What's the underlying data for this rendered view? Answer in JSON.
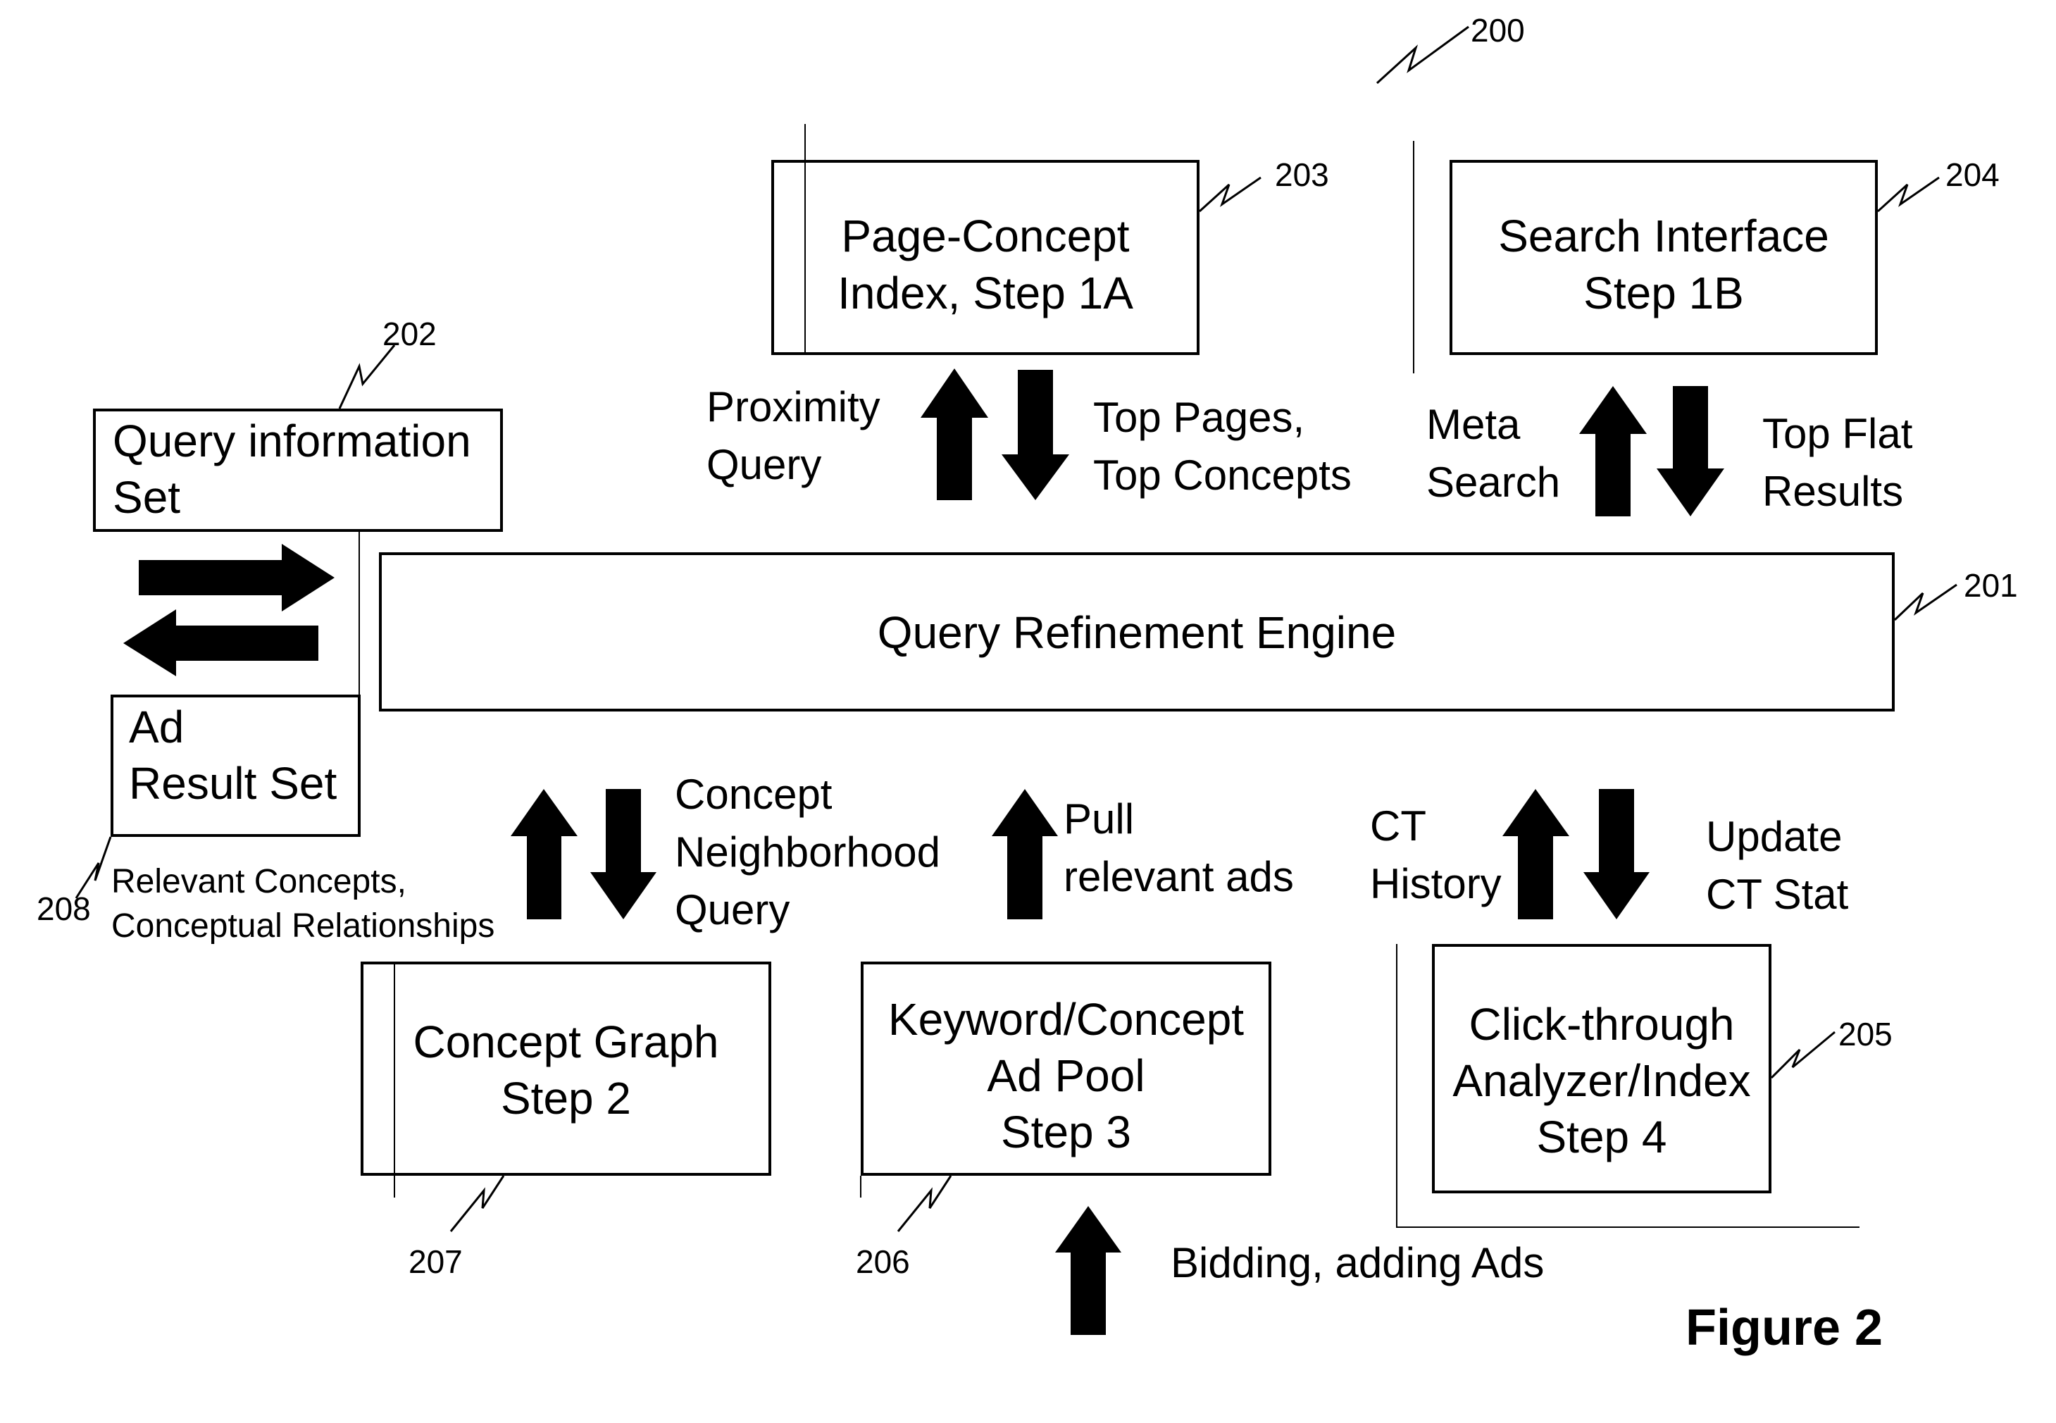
{
  "figure_label": "Figure 2",
  "diagram_ref": "200",
  "nodes": {
    "engine": {
      "label": "Query Refinement Engine",
      "ref": "201"
    },
    "query_info": {
      "line1": "Query information",
      "line2": "Set",
      "ref": "202"
    },
    "page_concept": {
      "line1": "Page-Concept",
      "line2": "Index, Step 1A",
      "ref": "203"
    },
    "search_interface": {
      "line1": "Search Interface",
      "line2": "Step 1B",
      "ref": "204"
    },
    "click_through": {
      "line1": "Click-through",
      "line2": "Analyzer/Index",
      "line3": "Step 4",
      "ref": "205"
    },
    "ad_pool": {
      "line1": "Keyword/Concept",
      "line2": "Ad Pool",
      "line3": "Step 3",
      "ref": "206"
    },
    "concept_graph": {
      "line1": "Concept Graph",
      "line2": "Step 2",
      "ref": "207"
    },
    "ad_result": {
      "line1": "Ad",
      "line2": "Result Set",
      "ref": "208"
    }
  },
  "edges": {
    "proximity_query": {
      "line1": "Proximity",
      "line2": "Query"
    },
    "top_pages": {
      "line1": "Top Pages,",
      "line2": "Top Concepts"
    },
    "meta_search": {
      "line1": "Meta",
      "line2": "Search"
    },
    "top_flat": {
      "line1": "Top Flat",
      "line2": "Results"
    },
    "concept_neighborhood": {
      "line1": "Concept",
      "line2": "Neighborhood",
      "line3": "Query"
    },
    "relevant_concepts": {
      "line1": "Relevant Concepts,",
      "line2": "Conceptual Relationships"
    },
    "pull_ads": {
      "line1": "Pull",
      "line2": "relevant ads"
    },
    "ct_history": {
      "line1": "CT",
      "line2": "History"
    },
    "update_ct": {
      "line1": "Update",
      "line2": "CT Stat"
    },
    "bidding": {
      "label": "Bidding, adding Ads"
    }
  }
}
